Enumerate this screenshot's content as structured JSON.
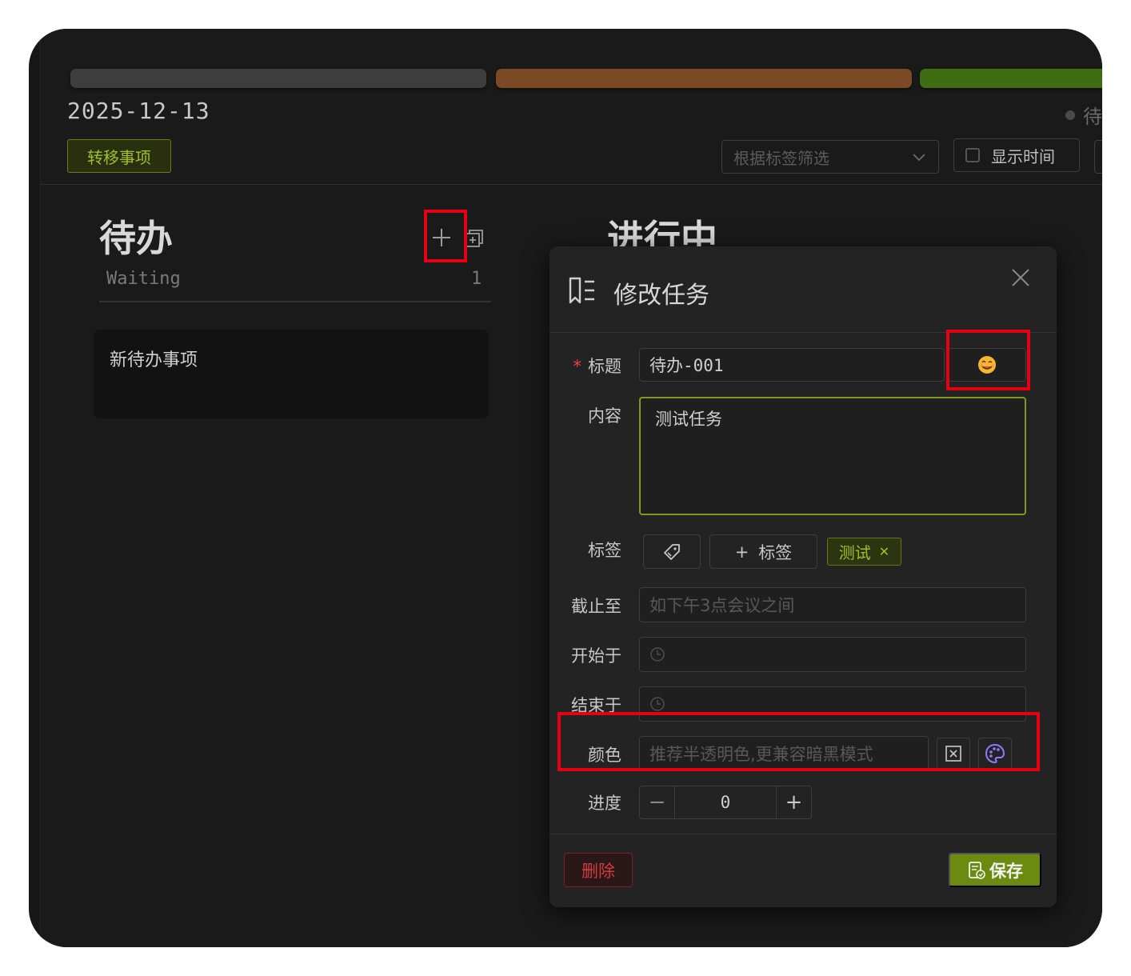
{
  "header": {
    "date": "2025-12-13",
    "status_right": "待",
    "transfer_label": "转移事项",
    "tag_filter_placeholder": "根据标签筛选",
    "show_time_label": "显示时间"
  },
  "columns": [
    {
      "title": "待办",
      "subtitle": "Waiting",
      "count": "1"
    },
    {
      "title": "进行中"
    }
  ],
  "cards": [
    {
      "title": "新待办事项"
    }
  ],
  "modal": {
    "title": "修改任务",
    "fields": {
      "title_label": "标题",
      "title_value": "待办-001",
      "content_label": "内容",
      "content_value": "测试任务",
      "tags_label": "标签",
      "add_tag_label": "标签",
      "tag_chip": "测试",
      "deadline_label": "截止至",
      "deadline_placeholder": "如下午3点会议之间",
      "start_label": "开始于",
      "end_label": "结束于",
      "color_label": "颜色",
      "color_placeholder": "推荐半透明色,更兼容暗黑模式",
      "progress_label": "进度",
      "progress_value": "0"
    },
    "delete_label": "删除",
    "save_label": "保存"
  },
  "colors": {
    "accent_green": "#6b8a10",
    "highlight_red": "#e60012",
    "danger_red": "#d23c3c",
    "bar_colors": [
      "#3d3d3d",
      "#7b4a24",
      "#3e6d14"
    ]
  },
  "icons": [
    "plus-icon",
    "copy-icon",
    "task-list-icon",
    "close-icon",
    "emoji-icon",
    "tag-icon",
    "clock-icon",
    "clear-icon",
    "palette-icon",
    "save-icon",
    "chevron-down-icon"
  ]
}
